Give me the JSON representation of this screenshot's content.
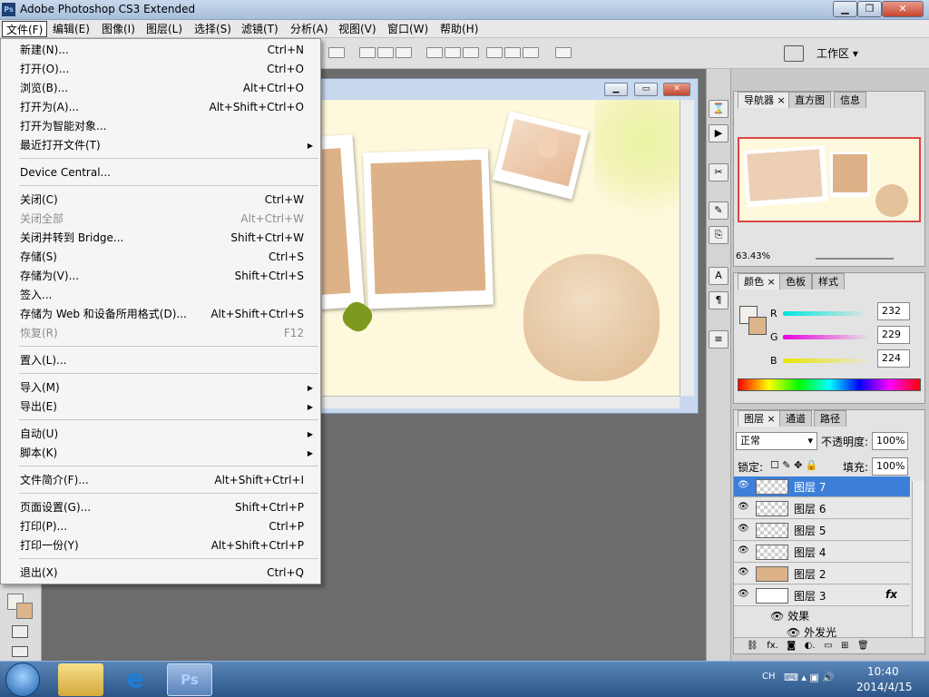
{
  "window": {
    "title": "Adobe Photoshop CS3 Extended",
    "logo_text": "Ps"
  },
  "menubar": {
    "items": [
      "文件(F)",
      "编辑(E)",
      "图像(I)",
      "图层(L)",
      "选择(S)",
      "滤镜(T)",
      "分析(A)",
      "视图(V)",
      "窗口(W)",
      "帮助(H)"
    ],
    "active_index": 0
  },
  "toolbar": {
    "workspace_label": "工作区 ▾"
  },
  "file_menu": {
    "items": [
      {
        "label": "新建(N)...",
        "shortcut": "Ctrl+N"
      },
      {
        "label": "打开(O)...",
        "shortcut": "Ctrl+O"
      },
      {
        "label": "浏览(B)...",
        "shortcut": "Alt+Ctrl+O"
      },
      {
        "label": "打开为(A)...",
        "shortcut": "Alt+Shift+Ctrl+O"
      },
      {
        "label": "打开为智能对象...",
        "shortcut": ""
      },
      {
        "label": "最近打开文件(T)",
        "shortcut": "",
        "submenu": true
      },
      {
        "label": "Device Central...",
        "shortcut": ""
      },
      {
        "label": "关闭(C)",
        "shortcut": "Ctrl+W"
      },
      {
        "label": "关闭全部",
        "shortcut": "Alt+Ctrl+W",
        "disabled": true
      },
      {
        "label": "关闭并转到 Bridge...",
        "shortcut": "Shift+Ctrl+W"
      },
      {
        "label": "存储(S)",
        "shortcut": "Ctrl+S"
      },
      {
        "label": "存储为(V)...",
        "shortcut": "Shift+Ctrl+S"
      },
      {
        "label": "签入...",
        "shortcut": ""
      },
      {
        "label": "存储为 Web 和设备所用格式(D)...",
        "shortcut": "Alt+Shift+Ctrl+S"
      },
      {
        "label": "恢复(R)",
        "shortcut": "F12",
        "disabled": true
      },
      {
        "label": "置入(L)...",
        "shortcut": ""
      },
      {
        "label": "导入(M)",
        "shortcut": "",
        "submenu": true
      },
      {
        "label": "导出(E)",
        "shortcut": "",
        "submenu": true
      },
      {
        "label": "自动(U)",
        "shortcut": "",
        "submenu": true
      },
      {
        "label": "脚本(K)",
        "shortcut": "",
        "submenu": true
      },
      {
        "label": "文件简介(F)...",
        "shortcut": "Alt+Shift+Ctrl+I"
      },
      {
        "label": "页面设置(G)...",
        "shortcut": "Shift+Ctrl+P"
      },
      {
        "label": "打印(P)...",
        "shortcut": "Ctrl+P"
      },
      {
        "label": "打印一份(Y)",
        "shortcut": "Alt+Shift+Ctrl+P"
      },
      {
        "label": "退出(X)",
        "shortcut": "Ctrl+Q"
      }
    ]
  },
  "navigator": {
    "tabs": [
      "导航器",
      "直方图",
      "信息"
    ],
    "zoom": "63.43%"
  },
  "color_panel": {
    "tabs": [
      "颜色",
      "色板",
      "样式"
    ],
    "r_label": "R",
    "g_label": "G",
    "b_label": "B",
    "r": "232",
    "g": "229",
    "b": "224",
    "foreground": "#f1efe9",
    "background": "#deb58a"
  },
  "layers_panel": {
    "tabs": [
      "图层",
      "通道",
      "路径"
    ],
    "blend_mode": "正常",
    "opacity_label": "不透明度:",
    "opacity": "100%",
    "lock_label": "锁定:",
    "fill_label": "填充:",
    "fill": "100%",
    "layers": [
      {
        "name": "图层 7",
        "selected": true
      },
      {
        "name": "图层 6"
      },
      {
        "name": "图层 5"
      },
      {
        "name": "图层 4"
      },
      {
        "name": "图层 2"
      },
      {
        "name": "图层 3",
        "fx": "fx"
      }
    ],
    "effects_label": "效果",
    "effect_item": "外发光"
  },
  "taskbar": {
    "lang": "CH",
    "time": "10:40",
    "date": "2014/4/15"
  }
}
